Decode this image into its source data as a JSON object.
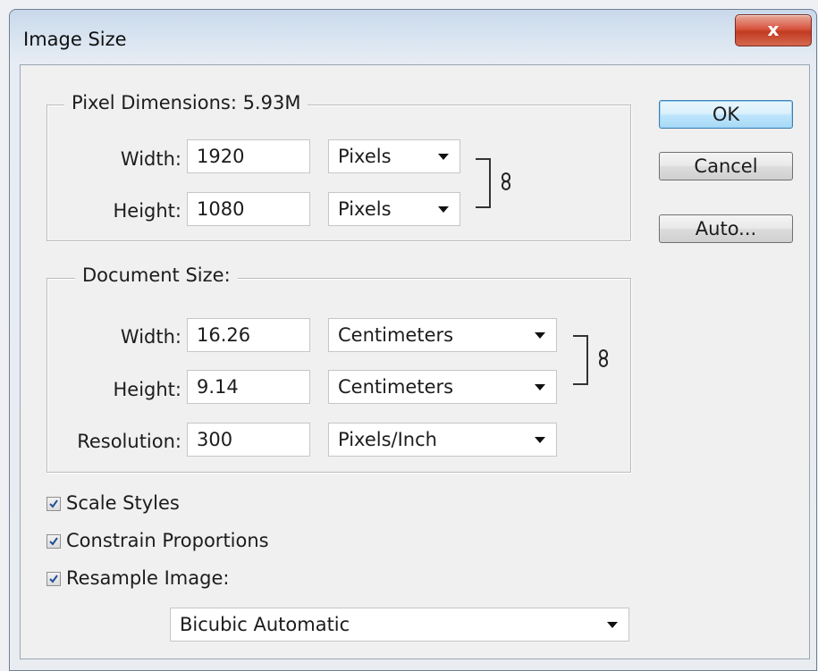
{
  "window": {
    "title": "Image Size",
    "close_label": "x"
  },
  "pixel_dimensions": {
    "legend": "Pixel Dimensions:  5.93M",
    "width": {
      "label": "Width:",
      "value": "1920",
      "unit": "Pixels"
    },
    "height": {
      "label": "Height:",
      "value": "1080",
      "unit": "Pixels"
    }
  },
  "document_size": {
    "legend": "Document Size:",
    "width": {
      "label": "Width:",
      "value": "16.26",
      "unit": "Centimeters"
    },
    "height": {
      "label": "Height:",
      "value": "9.14",
      "unit": "Centimeters"
    },
    "resolution": {
      "label": "Resolution:",
      "value": "300",
      "unit": "Pixels/Inch"
    }
  },
  "buttons": {
    "ok": "OK",
    "cancel": "Cancel",
    "auto": "Auto..."
  },
  "options": {
    "scale_styles": {
      "label": "Scale Styles",
      "checked": true
    },
    "constrain_proportions": {
      "label": "Constrain Proportions",
      "checked": true
    },
    "resample_image": {
      "label": "Resample Image:",
      "checked": true
    }
  },
  "resample_method": "Bicubic Automatic"
}
